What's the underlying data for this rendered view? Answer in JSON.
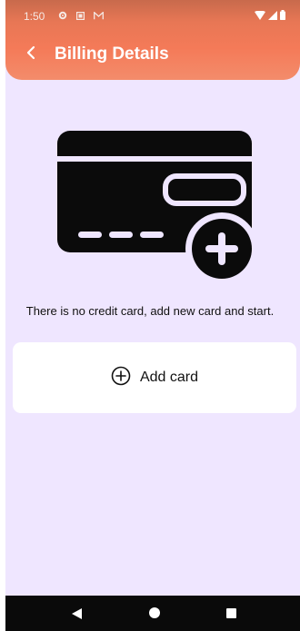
{
  "status_bar": {
    "time": "1:50",
    "icons_left": [
      "settings-icon",
      "notification-box-icon",
      "mail-icon"
    ],
    "icons_right": [
      "wifi-icon",
      "signal-icon",
      "battery-icon"
    ]
  },
  "app_bar": {
    "title": "Billing Details",
    "back_icon": "chevron-left-icon"
  },
  "empty_state": {
    "illustration_icon": "credit-card-add-icon",
    "message": "There is no credit card, add new card and start."
  },
  "add_card_button": {
    "icon": "plus-circle-icon",
    "label": "Add card"
  },
  "nav_bar": {
    "items": [
      "back-triangle-icon",
      "home-circle-icon",
      "recents-square-icon"
    ]
  },
  "colors": {
    "header_accent": "#f47a58",
    "background": "#efe6ff",
    "card_illustration": "#0b0b0b"
  }
}
